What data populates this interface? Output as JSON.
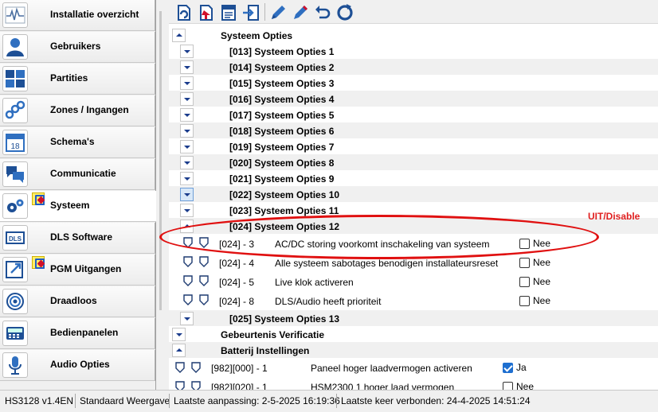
{
  "sidebar": {
    "items": [
      {
        "label": "Installatie overzicht",
        "icon": "pulse-icon"
      },
      {
        "label": "Gebruikers",
        "icon": "user-icon"
      },
      {
        "label": "Partities",
        "icon": "partitions-icon"
      },
      {
        "label": "Zones / Ingangen",
        "icon": "zones-icon"
      },
      {
        "label": "Schema's",
        "icon": "calendar-icon"
      },
      {
        "label": "Communicatie",
        "icon": "chat-icon"
      },
      {
        "label": "Systeem",
        "icon": "gears-icon"
      },
      {
        "label": "DLS Software",
        "icon": "dls-icon"
      },
      {
        "label": "PGM Uitgangen",
        "icon": "pgm-icon"
      },
      {
        "label": "Draadloos",
        "icon": "wireless-icon"
      },
      {
        "label": "Bedienpanelen",
        "icon": "keypad-icon"
      },
      {
        "label": "Audio Opties",
        "icon": "microphone-icon"
      }
    ]
  },
  "tree": {
    "top_group": "Systeem Opties",
    "sub_groups": [
      "[013] Systeem Opties 1",
      "[014] Systeem Opties 2",
      "[015] Systeem Opties 3",
      "[016] Systeem Opties 4",
      "[017] Systeem Opties 5",
      "[018] Systeem Opties 6",
      "[019] Systeem Opties 7",
      "[020] Systeem Opties 8",
      "[021] Systeem Opties 9",
      "[022] Systeem Opties 10",
      "[023] Systeem Opties 11",
      "[024] Systeem Opties 12"
    ],
    "options_024": [
      {
        "code": "[024] - 3",
        "desc": "AC/DC storing voorkomt inschakeling van systeem",
        "value": "Nee"
      },
      {
        "code": "[024] - 4",
        "desc": "Alle systeem sabotages benodigen installateursreset",
        "value": "Nee"
      },
      {
        "code": "[024] - 5",
        "desc": "Live klok activeren",
        "value": "Nee"
      },
      {
        "code": "[024] - 8",
        "desc": "DLS/Audio heeft prioriteit",
        "value": "Nee"
      }
    ],
    "group_025": "[025] Systeem Opties 13",
    "group_verif": "Gebeurtenis Verificatie",
    "group_battery": "Batterij Instellingen",
    "battery_options": [
      {
        "code": "[982][000] - 1",
        "desc": "Paneel hoger laadvermogen activeren",
        "value": "Ja",
        "checked": true
      },
      {
        "code": "[982][020] - 1",
        "desc": "HSM2300 1 hoger laad vermogen",
        "value": "Nee",
        "checked": false
      }
    ]
  },
  "annotation": {
    "text": "UIT/Disable",
    "color": "#e01010"
  },
  "statusbar": {
    "version": "HS3128 v1.4EN",
    "view": "Standaard Weergave",
    "last_change": "Laatste aanpassing: 2-5-2025 16:19:36",
    "last_connected": "Laatste keer verbonden: 24-4-2025 14:51:24"
  },
  "colors": {
    "accent": "#1a3c8c",
    "checkbox_on": "#1e6fd0"
  }
}
